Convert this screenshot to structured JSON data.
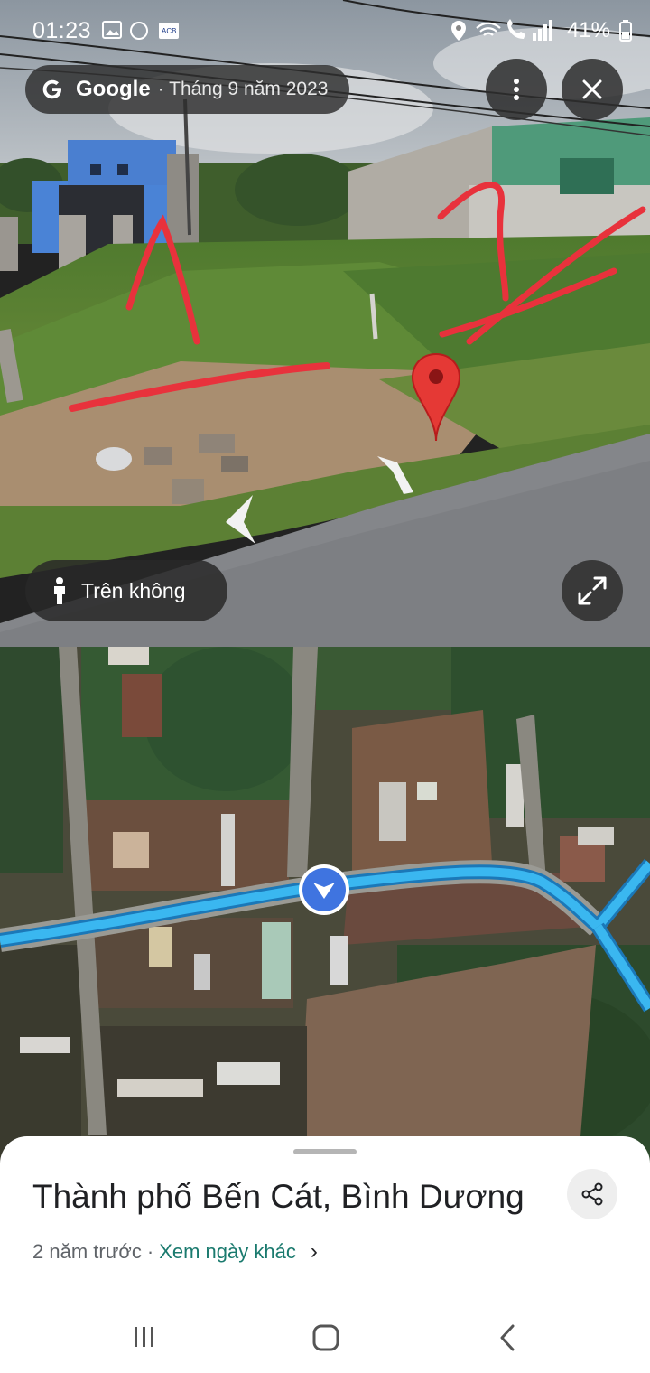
{
  "status_bar": {
    "time": "01:23",
    "battery": "41%"
  },
  "street_view": {
    "provider": "Google",
    "date": "· Tháng 9 năm 2023",
    "aerial_label": "Trên không",
    "icons": {
      "menu": "more-vert-icon",
      "close": "close-icon",
      "expand": "expand-icon",
      "person": "person-icon",
      "pin": "map-pin-icon"
    },
    "pin_color": "#e53935"
  },
  "map": {
    "route_color": "#3ab7f0",
    "location_color": "#3f74e0"
  },
  "sheet": {
    "place_title": "Thành phố Bến Cát, Bình Dương",
    "age": "2 năm trước",
    "other_dates": "Xem ngày khác",
    "chevron": "›"
  },
  "nav": {
    "recents": "recents-icon",
    "home": "home-icon",
    "back": "back-icon"
  }
}
